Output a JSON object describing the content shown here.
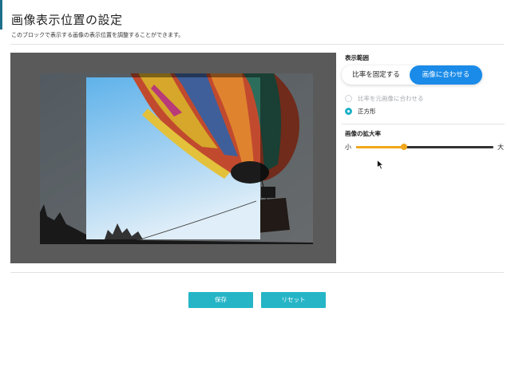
{
  "header": {
    "title": "画像表示位置の設定",
    "description": "このブロックで表示する画像の表示位置を調整することができます。"
  },
  "display_range": {
    "label": "表示範囲",
    "options": [
      "比率を固定する",
      "画像に合わせる"
    ],
    "selected": "画像に合わせる"
  },
  "aspect": {
    "options": [
      {
        "label": "比率を元画像に合わせる",
        "selected": false,
        "disabled": true
      },
      {
        "label": "正方形",
        "selected": true,
        "disabled": false
      }
    ]
  },
  "zoom": {
    "label": "画像の拡大率",
    "min_label": "小",
    "max_label": "大",
    "value_fraction": 0.35
  },
  "actions": {
    "save_label": "保存",
    "reset_label": "リセット"
  },
  "colors": {
    "accent": "#1a8be8",
    "button": "#25b5c7",
    "slider": "#f2a71b",
    "radio_on": "#1fb0c8"
  }
}
